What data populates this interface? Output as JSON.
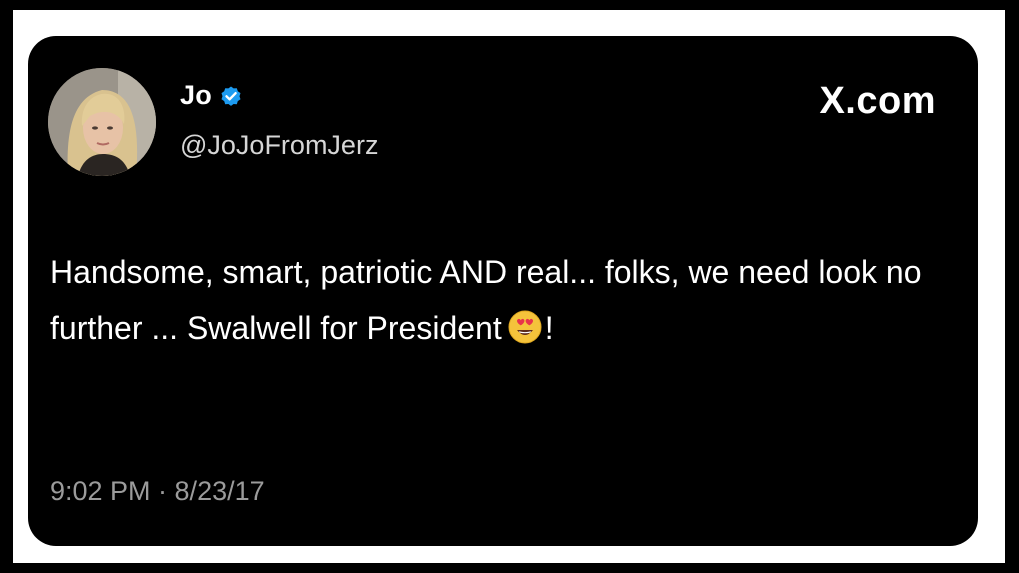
{
  "author": {
    "display_name": "Jo",
    "handle": "@JoJoFromJerz",
    "verified_icon": "verified-badge-icon",
    "avatar": "avatar-photo"
  },
  "brand": {
    "label": "X.com",
    "icon": "x-logo-icon"
  },
  "tweet": {
    "text_before_emoji": "Handsome, smart, patriotic AND real... folks, we need look no further ... Swalwell for President",
    "emoji": "heart-eyes-emoji",
    "text_after_emoji": "!"
  },
  "meta": {
    "timestamp": "9:02 PM · 8/23/17"
  },
  "colors": {
    "card_background": "#000000",
    "border": "#ffffff",
    "text_primary": "#ffffff",
    "text_secondary": "#9b9b9b",
    "verified_blue": "#1d9bf0"
  }
}
